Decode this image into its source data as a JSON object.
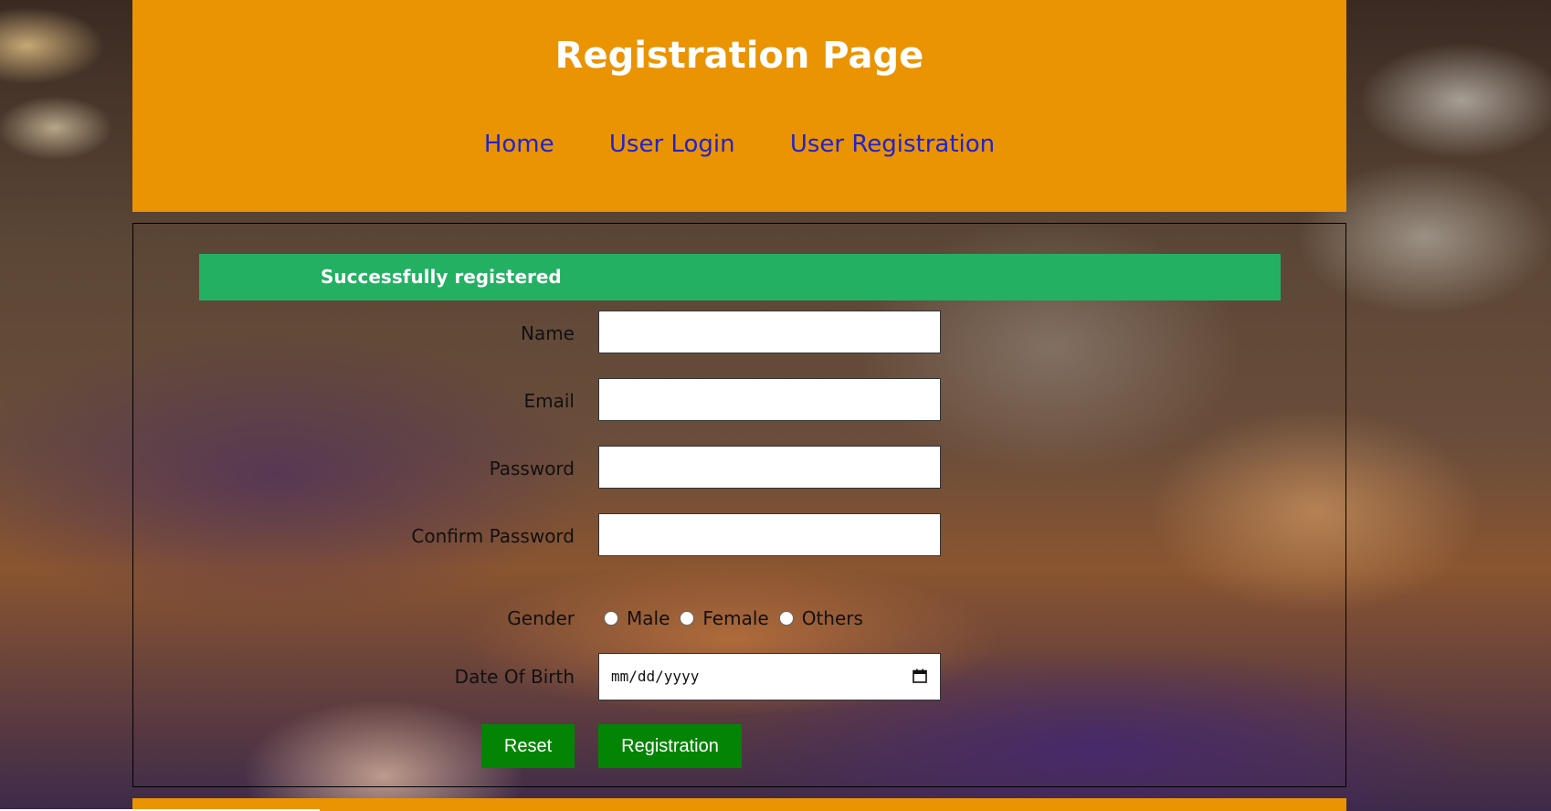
{
  "header": {
    "title": "Registration Page",
    "nav": [
      "Home",
      "User Login",
      "User Registration"
    ]
  },
  "alert": {
    "message": "Successfully registered"
  },
  "form": {
    "name_label": "Name",
    "email_label": "Email",
    "password_label": "Password",
    "confirm_password_label": "Confirm Password",
    "gender_label": "Gender",
    "gender_options": [
      "Male",
      "Female",
      "Others"
    ],
    "dob_label": "Date Of Birth",
    "dob_placeholder": "mm/dd/yyyy",
    "name_value": "",
    "email_value": "",
    "password_value": "",
    "confirm_password_value": ""
  },
  "buttons": {
    "reset": "Reset",
    "register": "Registration"
  },
  "colors": {
    "header_bg": "#ea9404",
    "nav_link": "#2222cc",
    "alert_bg": "#24b063",
    "button_bg": "#048404"
  },
  "icons": {
    "date_picker": "calendar-icon"
  }
}
